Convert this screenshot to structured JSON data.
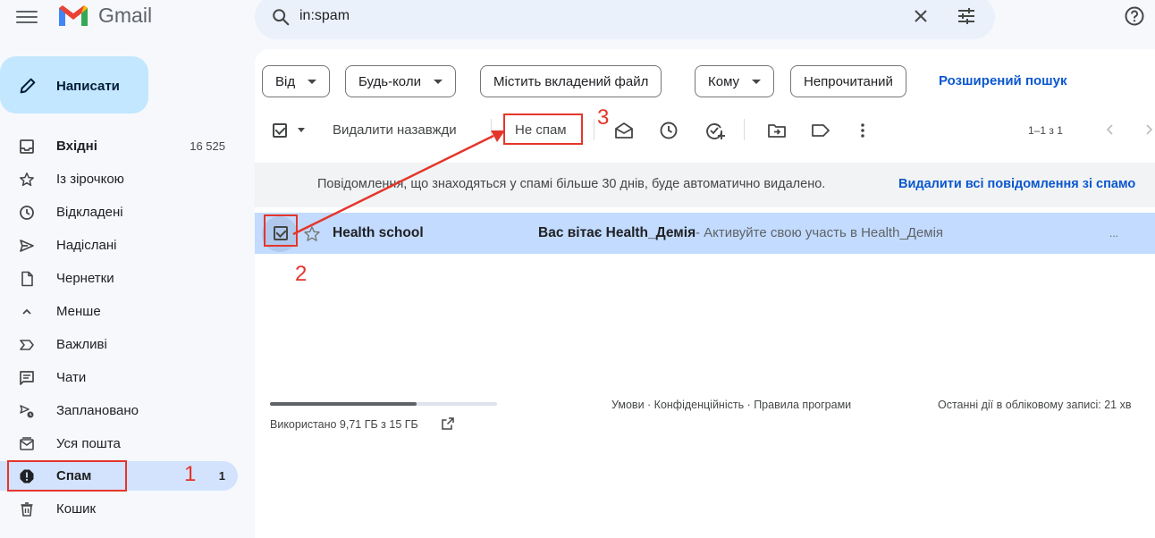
{
  "header": {
    "logo_text": "Gmail",
    "search_value": "in:spam"
  },
  "sidebar": {
    "compose_label": "Написати",
    "items": [
      {
        "label": "Вхідні",
        "count": "16 525",
        "icon": "inbox-icon"
      },
      {
        "label": "Із зірочкою",
        "count": "",
        "icon": "star-icon"
      },
      {
        "label": "Відкладені",
        "count": "",
        "icon": "clock-icon"
      },
      {
        "label": "Надіслані",
        "count": "",
        "icon": "send-icon"
      },
      {
        "label": "Чернетки",
        "count": "",
        "icon": "draft-icon"
      },
      {
        "label": "Менше",
        "count": "",
        "icon": "chevron-up-icon"
      },
      {
        "label": "Важливі",
        "count": "",
        "icon": "important-icon"
      },
      {
        "label": "Чати",
        "count": "",
        "icon": "chat-icon"
      },
      {
        "label": "Заплановано",
        "count": "",
        "icon": "scheduled-icon"
      },
      {
        "label": "Уся пошта",
        "count": "",
        "icon": "all-mail-icon"
      },
      {
        "label": "Спам",
        "count": "1",
        "icon": "spam-icon"
      },
      {
        "label": "Кошик",
        "count": "",
        "icon": "trash-icon"
      }
    ]
  },
  "filters": {
    "from": "Від",
    "any_time": "Будь-коли",
    "has_attachment": "Містить вкладений файл",
    "to": "Кому",
    "unread": "Непрочитаний",
    "advanced_search": "Розширений пошук"
  },
  "toolbar": {
    "delete_forever": "Видалити назавжди",
    "not_spam": "Не спам",
    "pager": "1–1 з 1"
  },
  "info": {
    "text": "Повідомлення, що знаходяться у спамі більше 30 днів, буде автоматично видалено.",
    "link": "Видалити всі повідомлення зі спамо"
  },
  "messages": [
    {
      "sender": "Health school",
      "subject": "Вас вітає Health_Демія",
      "snippet": "- Активуйте свою участь в Health_Демія",
      "more": "..."
    }
  ],
  "footer": {
    "storage_text": "Використано 9,71 ГБ з 15 ГБ",
    "storage_used_fraction": 0.647,
    "links": "Умови · Конфіденційність · Правила програми",
    "activity": "Останні дії в обліковому записі: 21 хв"
  },
  "annotations": {
    "one": "1",
    "two": "2",
    "three": "3",
    "color": "#e5352b"
  }
}
